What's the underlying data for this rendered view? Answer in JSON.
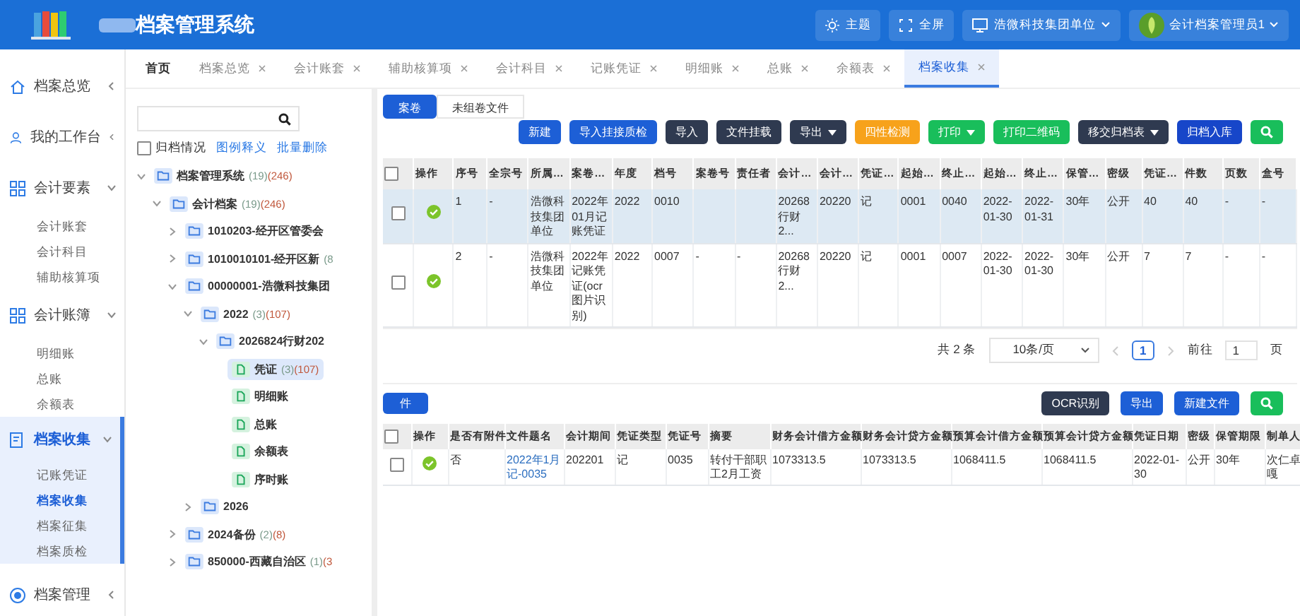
{
  "header": {
    "title": "档案管理系统",
    "actions": [
      {
        "kind": "theme",
        "label": "主题"
      },
      {
        "kind": "fullscreen",
        "label": "全屏"
      },
      {
        "kind": "unit",
        "label": "浩微科技集团单位"
      }
    ],
    "user": "会计档案管理员1"
  },
  "sidebar": {
    "items": [
      {
        "label": "档案总览",
        "expanded": false,
        "active": false
      },
      {
        "label": "我的工作台",
        "expanded": false,
        "active": false
      },
      {
        "label": "会计要素",
        "expanded": true,
        "active": false,
        "children": [
          {
            "label": "会计账套",
            "selected": false
          },
          {
            "label": "会计科目",
            "selected": false
          },
          {
            "label": "辅助核算项",
            "selected": false
          }
        ]
      },
      {
        "label": "会计账簿",
        "expanded": true,
        "active": false,
        "children": [
          {
            "label": "明细账",
            "selected": false
          },
          {
            "label": "总账",
            "selected": false
          },
          {
            "label": "余额表",
            "selected": false
          }
        ]
      },
      {
        "label": "档案收集",
        "expanded": true,
        "active": true,
        "children": [
          {
            "label": "记账凭证",
            "selected": false
          },
          {
            "label": "档案收集",
            "selected": true
          },
          {
            "label": "档案征集",
            "selected": false
          },
          {
            "label": "档案质检",
            "selected": false
          }
        ]
      },
      {
        "label": "档案管理",
        "expanded": false,
        "active": false
      }
    ]
  },
  "tabs": [
    {
      "label": "首页",
      "closable": false,
      "selected": false
    },
    {
      "label": "档案总览",
      "closable": true,
      "selected": false
    },
    {
      "label": "会计账套",
      "closable": true,
      "selected": false
    },
    {
      "label": "辅助核算项",
      "closable": true,
      "selected": false
    },
    {
      "label": "会计科目",
      "closable": true,
      "selected": false
    },
    {
      "label": "记账凭证",
      "closable": true,
      "selected": false
    },
    {
      "label": "明细账",
      "closable": true,
      "selected": false
    },
    {
      "label": "总账",
      "closable": true,
      "selected": false
    },
    {
      "label": "余额表",
      "closable": true,
      "selected": false
    },
    {
      "label": "档案收集",
      "closable": true,
      "selected": true
    }
  ],
  "tree_panel": {
    "archived_filter": {
      "label": "归档情况",
      "checked": false
    },
    "links": [
      "图例释义",
      "批量删除"
    ],
    "tree": [
      {
        "name": "档案管理系统",
        "count_a": "(19)",
        "count_b": "(246)",
        "kind": "folder",
        "expanded": true,
        "selected": false,
        "children": [
          {
            "name": "会计档案",
            "count_a": "(19)",
            "count_b": "(246)",
            "kind": "folder",
            "expanded": true,
            "selected": false,
            "children": [
              {
                "name": "1010203-经开区管委会",
                "kind": "folder",
                "expanded": false,
                "selected": false
              },
              {
                "name": "1010010101-经开区新",
                "count_a": "(8",
                "kind": "folder",
                "expanded": false,
                "selected": false
              },
              {
                "name": "00000001-浩微科技集团",
                "kind": "folder",
                "expanded": true,
                "selected": false,
                "children": [
                  {
                    "name": "2022",
                    "count_a": "(3)",
                    "count_b": "(107)",
                    "kind": "folder",
                    "expanded": true,
                    "selected": false,
                    "children": [
                      {
                        "name": "2026824行财202",
                        "kind": "folder",
                        "expanded": true,
                        "selected": false,
                        "children": [
                          {
                            "name": "凭证",
                            "count_a": "(3)",
                            "count_b": "(107)",
                            "kind": "file",
                            "selected": true
                          },
                          {
                            "name": "明细账",
                            "kind": "file",
                            "selected": false
                          },
                          {
                            "name": "总账",
                            "kind": "file",
                            "selected": false
                          },
                          {
                            "name": "余额表",
                            "kind": "file",
                            "selected": false
                          },
                          {
                            "name": "序时账",
                            "kind": "file",
                            "selected": false
                          }
                        ]
                      }
                    ]
                  },
                  {
                    "name": "2026",
                    "kind": "folder",
                    "expanded": false,
                    "selected": false
                  }
                ]
              },
              {
                "name": "2024备份",
                "count_a": "(2)",
                "count_b": "(8)",
                "kind": "folder",
                "expanded": false,
                "selected": false
              },
              {
                "name": "850000-西藏自治区",
                "count_a": "(1)",
                "count_b": "(3",
                "kind": "folder",
                "expanded": false,
                "selected": false
              }
            ]
          }
        ]
      }
    ]
  },
  "sub_tabs": [
    {
      "label": "案卷",
      "selected": true
    },
    {
      "label": "未组卷文件",
      "selected": false
    }
  ],
  "toolbar": [
    {
      "label": "新建",
      "color": "#1d5fd6",
      "dropdown": false,
      "kind": "text"
    },
    {
      "label": "导入挂接质检",
      "color": "#1d5fd6",
      "dropdown": false,
      "kind": "text"
    },
    {
      "label": "导入",
      "color": "#2f3a50",
      "dropdown": false,
      "kind": "text"
    },
    {
      "label": "文件挂载",
      "color": "#2f3a50",
      "dropdown": false,
      "kind": "text"
    },
    {
      "label": "导出",
      "color": "#2f3a50",
      "dropdown": true,
      "kind": "text"
    },
    {
      "label": "四性检测",
      "color": "#f7a21b",
      "dropdown": false,
      "kind": "text"
    },
    {
      "label": "打印",
      "color": "#19be5b",
      "dropdown": true,
      "kind": "text"
    },
    {
      "label": "打印二维码",
      "color": "#19be5b",
      "dropdown": false,
      "kind": "text"
    },
    {
      "label": "移交归档表",
      "color": "#2f3a50",
      "dropdown": true,
      "kind": "text"
    },
    {
      "label": "归档入库",
      "color": "#1746c9",
      "dropdown": false,
      "kind": "text"
    },
    {
      "color": "#19be5b",
      "dropdown": false,
      "kind": "search"
    }
  ],
  "volume_table": {
    "columns": [
      "操作",
      "序号",
      "全宗号",
      "所属…",
      "案卷…",
      "年度",
      "档号",
      "案卷号",
      "责任者",
      "会计…",
      "会计…",
      "凭证…",
      "起始…",
      "终止…",
      "起始…",
      "终止…",
      "保管…",
      "密级",
      "凭证…",
      "件数",
      "页数",
      "盒号"
    ],
    "all_checked": false,
    "rows": [
      {
        "checked": false,
        "selected": true,
        "passed": true,
        "cells": [
          "",
          "1",
          "-",
          "浩微科技集团单位",
          "2022年01月记账凭证",
          "2022",
          "0010",
          "",
          "",
          "20268行财2...",
          "20220",
          "记",
          "0001",
          "0040",
          "2022-01-30",
          "2022-01-31",
          "30年",
          "公开",
          "40",
          "40",
          "-",
          "-"
        ]
      },
      {
        "checked": false,
        "selected": false,
        "passed": true,
        "cells": [
          "",
          "2",
          "-",
          "浩微科技集团单位",
          "2022年记账凭证(ocr图片识别)",
          "2022",
          "0007",
          "-",
          "-",
          "20268行财2...",
          "20220",
          "记",
          "0001",
          "0007",
          "2022-01-30",
          "2022-01-30",
          "30年",
          "公开",
          "7",
          "7",
          "-",
          "-"
        ]
      }
    ]
  },
  "pagination": {
    "total": "共 2 条",
    "page_size": "10条/页",
    "pages": [
      {
        "label": "1",
        "selected": true
      }
    ],
    "goto_label": "前往",
    "goto_value": "1",
    "goto_unit": "页"
  },
  "file_section": {
    "tab": "件",
    "buttons": [
      {
        "label": "OCR识别",
        "color": "#2f3a50",
        "kind": "text"
      },
      {
        "label": "导出",
        "color": "#1d5fd6",
        "kind": "text"
      },
      {
        "label": "新建文件",
        "color": "#1d5fd6",
        "kind": "text"
      },
      {
        "color": "#19be5b",
        "kind": "search"
      }
    ],
    "columns": [
      "操作",
      "是否有附件",
      "文件题名",
      "会计期间",
      "凭证类型",
      "凭证号",
      "摘要",
      "财务会计借方金额",
      "财务会计贷方金额",
      "预算会计借方金额",
      "预算会计贷方金额",
      "凭证日期",
      "密级",
      "保管期限",
      "制单人"
    ],
    "all_checked": false,
    "rows": [
      {
        "checked": false,
        "passed": true,
        "cells": [
          "",
          "否",
          "2022年1月记-0035",
          "202201",
          "记",
          "0035",
          "转付干部职工2月工资",
          "1073313.5",
          "1073313.5",
          "1068411.5",
          "1068411.5",
          "2022-01-30",
          "公开",
          "30年",
          "次仁卓嘎"
        ]
      }
    ]
  }
}
